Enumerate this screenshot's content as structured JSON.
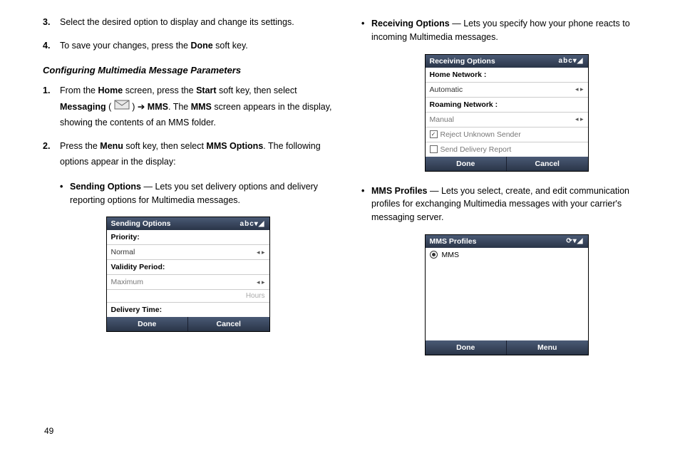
{
  "leftColumn": {
    "item3": {
      "num": "3.",
      "text": "Select the desired option to display and change its settings."
    },
    "item4": {
      "num": "4.",
      "text_a": "To save your changes, press the ",
      "bold_done": "Done",
      "text_b": " soft key."
    },
    "heading": "Configuring Multimedia Message Parameters",
    "step1": {
      "num": "1.",
      "a": "From the ",
      "home": "Home",
      "b": " screen, press the ",
      "start": "Start",
      "c": " soft key, then select ",
      "messaging": "Messaging",
      "d": " ( ",
      "e": " ) ",
      "arrow": "➔",
      "f": " ",
      "mms1": "MMS",
      "g": ". The ",
      "mms2": "MMS",
      "h": " screen appears in the display, showing the contents of an MMS folder."
    },
    "step2": {
      "num": "2.",
      "a": "Press the ",
      "menu": "Menu",
      "b": " soft key, then select ",
      "mmsopt": "MMS Options",
      "c": ". The following options appear in the display:"
    },
    "bullet_sending": {
      "bold": "Sending Options",
      "dash": " — ",
      "rest": "Lets you set delivery options and delivery reporting options for Multimedia messages."
    }
  },
  "rightColumn": {
    "bullet_receiving": {
      "bold": "Receiving Options",
      "dash": " — ",
      "rest": "Lets you specify how your phone reacts to incoming Multimedia messages."
    },
    "bullet_profiles": {
      "bold": "MMS Profiles",
      "dash": " — ",
      "rest": "Lets you select, create, and edit communication profiles for exchanging Multimedia messages with your carrier's messaging server."
    }
  },
  "screenshots": {
    "sending": {
      "title": "Sending Options",
      "status": "abc▾◢",
      "priority_label": "Priority:",
      "priority_value": "Normal",
      "validity_label": "Validity Period:",
      "validity_value": "Maximum",
      "hours": "Hours",
      "delivery_label": "Delivery Time:",
      "left_soft": "Done",
      "right_soft": "Cancel",
      "arrows": "◂ ▸"
    },
    "receiving": {
      "title": "Receiving Options",
      "status": "abc▾◢",
      "home_label": "Home Network :",
      "home_value": "Automatic",
      "roaming_label": "Roaming Network :",
      "roaming_value": "Manual",
      "reject": "Reject Unknown Sender",
      "delivery_report": "Send Delivery Report",
      "left_soft": "Done",
      "right_soft": "Cancel",
      "arrows": "◂ ▸"
    },
    "profiles": {
      "title": "MMS Profiles",
      "status": "⟳▾◢",
      "option": "MMS",
      "left_soft": "Done",
      "right_soft": "Menu"
    }
  },
  "pageNum": "49"
}
